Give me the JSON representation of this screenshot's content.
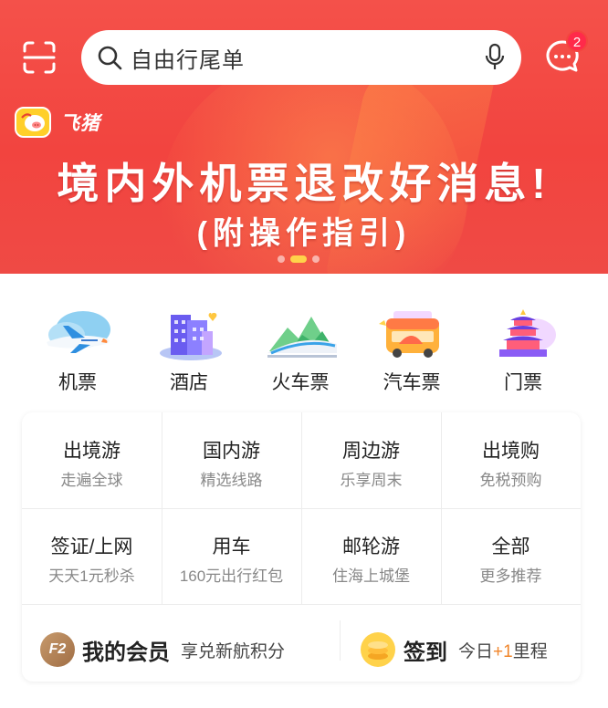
{
  "search": {
    "text": "自由行尾单"
  },
  "messages": {
    "badge_count": "2"
  },
  "brand": {
    "name": "飞猪"
  },
  "banner": {
    "title": "境内外机票退改好消息!",
    "subtitle": "(附操作指引)",
    "page_count": 3,
    "active_page": 1
  },
  "categories": [
    {
      "label": "机票",
      "icon": "airplane-icon"
    },
    {
      "label": "酒店",
      "icon": "hotel-icon"
    },
    {
      "label": "火车票",
      "icon": "train-icon"
    },
    {
      "label": "汽车票",
      "icon": "bus-icon"
    },
    {
      "label": "门票",
      "icon": "temple-icon"
    }
  ],
  "services": [
    {
      "title": "出境游",
      "subtitle": "走遍全球"
    },
    {
      "title": "国内游",
      "subtitle": "精选线路"
    },
    {
      "title": "周边游",
      "subtitle": "乐享周末"
    },
    {
      "title": "出境购",
      "subtitle": "免税预购"
    },
    {
      "title": "签证/上网",
      "subtitle": "天天1元秒杀"
    },
    {
      "title": "用车",
      "subtitle": "160元出行红包"
    },
    {
      "title": "邮轮游",
      "subtitle": "住海上城堡"
    },
    {
      "title": "全部",
      "subtitle": "更多推荐"
    }
  ],
  "member": {
    "badge": "F2",
    "title": "我的会员",
    "subtitle": "享兑新航积分"
  },
  "checkin": {
    "title": "签到",
    "prefix": "今日",
    "plus": "+1",
    "suffix": "里程"
  },
  "colors": {
    "banner_red": "#f2443f",
    "accent_orange": "#f0852a",
    "dot_active": "#ffd34a"
  }
}
